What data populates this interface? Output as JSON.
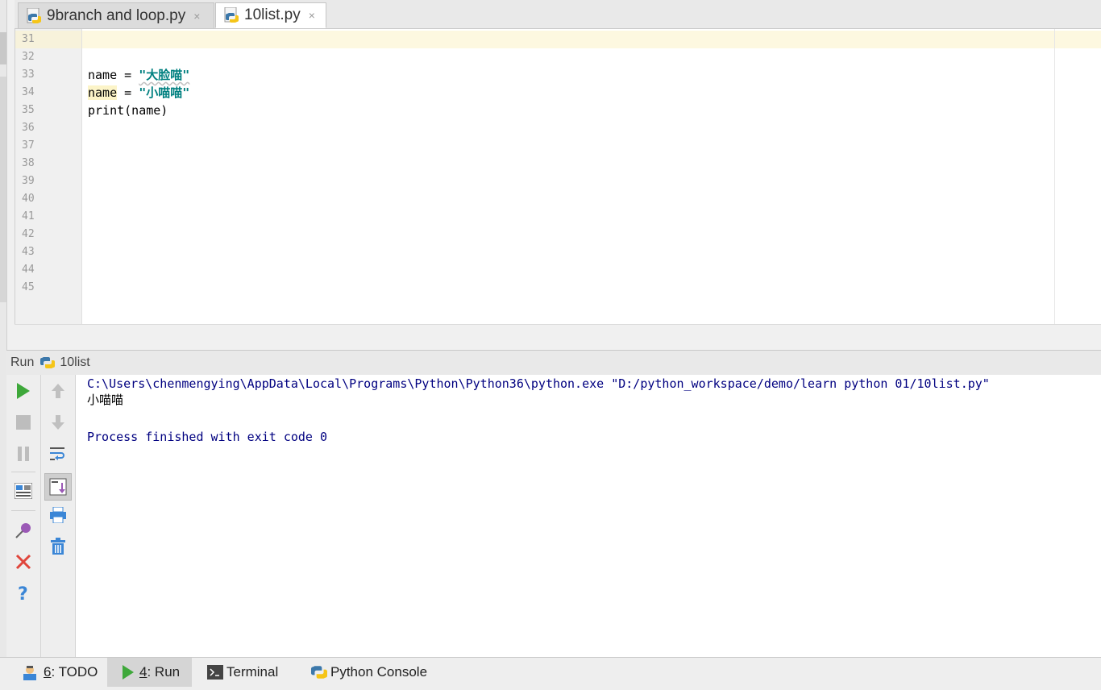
{
  "editor_tabs": [
    {
      "label": "9branch and loop.py",
      "active": false
    },
    {
      "label": "10list.py",
      "active": true
    }
  ],
  "close_glyph": "×",
  "editor": {
    "line_numbers": [
      "31",
      "32",
      "33",
      "34",
      "35",
      "36",
      "37",
      "38",
      "39",
      "40",
      "41",
      "42",
      "43",
      "44",
      "45"
    ],
    "code_lines": {
      "l33": {
        "var": "name",
        "op": " = ",
        "str": "\"大脸喵\""
      },
      "l34": {
        "var": "name",
        "op": " = ",
        "str": "\"小喵喵\""
      },
      "l35": {
        "text": "print(name)"
      }
    }
  },
  "run_panel": {
    "title": "Run",
    "config_name": "10list"
  },
  "console": {
    "command": "C:\\Users\\chenmengying\\AppData\\Local\\Programs\\Python\\Python36\\python.exe \"D:/python_workspace/demo/learn python 01/10list.py\"",
    "output": "小喵喵",
    "exit_message": "Process finished with exit code 0"
  },
  "bottom_tabs": [
    {
      "num": "6",
      "label": ": TODO",
      "icon": "todo-icon",
      "active": false
    },
    {
      "num": "4",
      "label": ": Run",
      "icon": "run-icon",
      "active": true
    },
    {
      "num": "",
      "label": "Terminal",
      "icon": "terminal-icon",
      "active": false
    },
    {
      "num": "",
      "label": "Python Console",
      "icon": "python-console-icon",
      "active": false
    }
  ],
  "colors": {
    "run_green": "#3ea83a",
    "stop_gray": "#bdbdbd",
    "close_red": "#e0453b",
    "help_blue": "#3b86d6",
    "console_blue": "#000080",
    "string_teal": "#008080"
  }
}
